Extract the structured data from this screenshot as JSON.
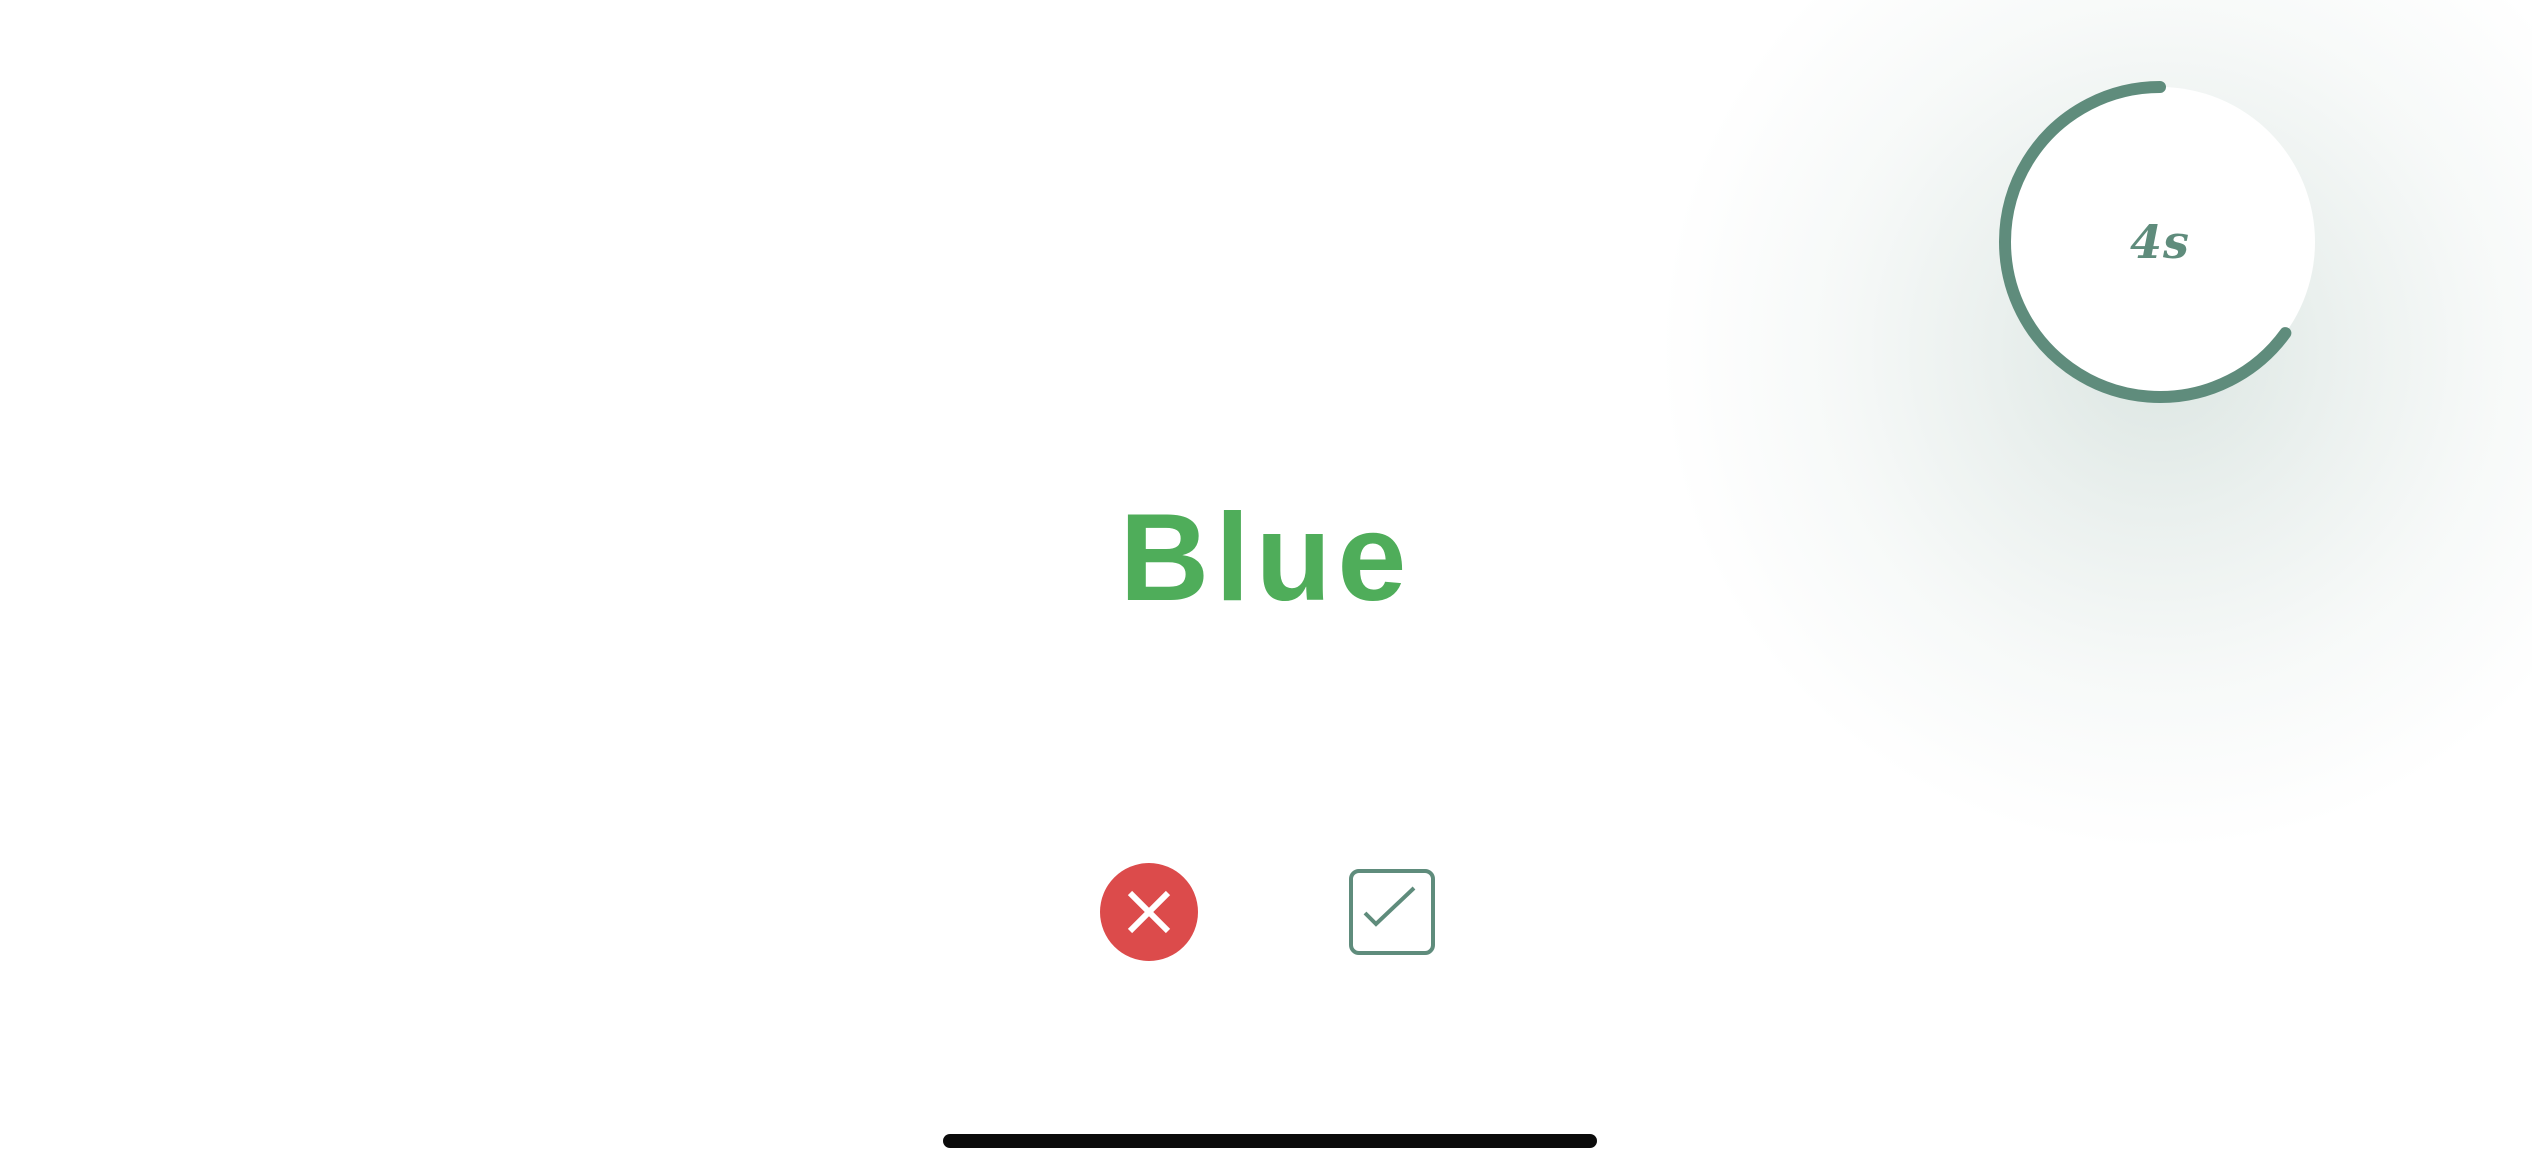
{
  "timer": {
    "label": "4s",
    "progress_fraction": 0.65,
    "ring_color": "#5f8c7c"
  },
  "prompt": {
    "word": "Blue",
    "ink_color": "#4fad5a"
  },
  "actions": {
    "reject_icon": "close-icon",
    "reject_color": "#dc4b4b",
    "accept_icon": "checkbox-check-icon",
    "accept_color": "#5f8c7c"
  },
  "system": {
    "home_indicator_color": "#0b0b0b"
  }
}
